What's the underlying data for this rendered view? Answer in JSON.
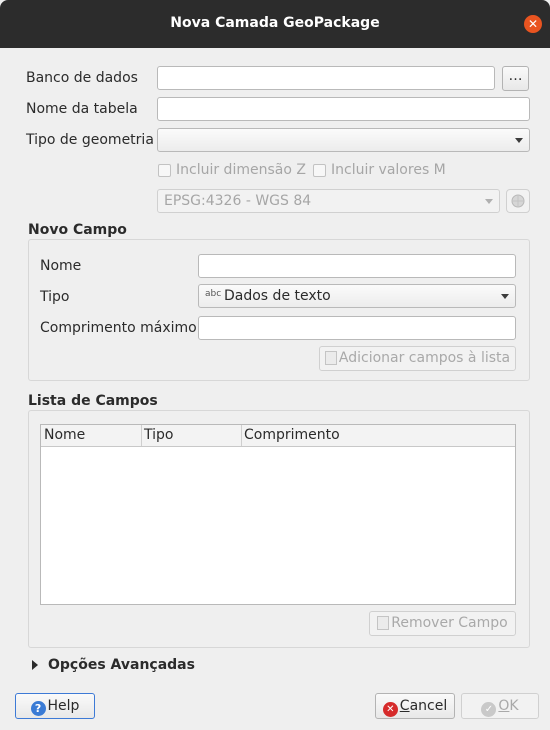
{
  "window": {
    "title": "Nova Camada GeoPackage",
    "close_icon": "close-icon"
  },
  "form": {
    "database_label": "Banco de dados",
    "database_value": "",
    "browse_label": "…",
    "table_name_label": "Nome da tabela",
    "table_name_value": "",
    "geometry_type_label": "Tipo de geometria",
    "geometry_type_value": "",
    "include_z_label": "Incluir dimensão Z",
    "include_m_label": "Incluir valores M",
    "crs_value": "EPSG:4326 - WGS 84"
  },
  "new_field": {
    "section_title": "Novo Campo",
    "name_label": "Nome",
    "name_value": "",
    "type_label": "Tipo",
    "type_icon_text": "abc",
    "type_value": "Dados de texto",
    "max_length_label": "Comprimento máximo",
    "max_length_value": "",
    "add_button": "Adicionar campos à lista"
  },
  "field_list": {
    "section_title": "Lista de Campos",
    "columns": [
      "Nome",
      "Tipo",
      "Comprimento"
    ],
    "rows": [],
    "remove_button": "Remover Campo"
  },
  "advanced": {
    "label": "Opções Avançadas"
  },
  "footer": {
    "help": "Help",
    "cancel_underline": "C",
    "cancel_rest": "ancel",
    "ok_underline": "O",
    "ok_rest": "K"
  }
}
